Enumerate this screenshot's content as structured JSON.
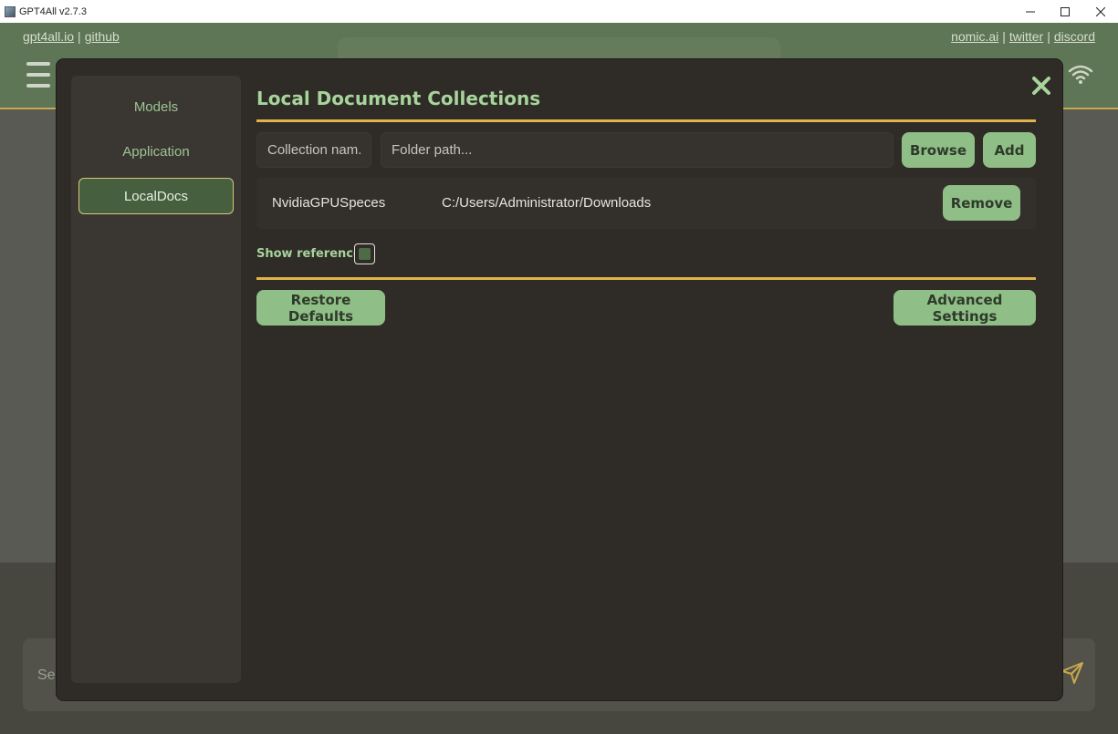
{
  "window": {
    "title": "GPT4All v2.7.3"
  },
  "header": {
    "links_left": [
      "gpt4all.io",
      "github"
    ],
    "links_right": [
      "nomic.ai",
      "twitter",
      "discord"
    ]
  },
  "input": {
    "placeholder": "Se"
  },
  "dialog": {
    "nav": {
      "models": "Models",
      "application": "Application",
      "localdocs": "LocalDocs",
      "active": "LocalDocs"
    },
    "title": "Local Document Collections",
    "collection_name_placeholder": "Collection nam...",
    "folder_path_placeholder": "Folder path...",
    "browse_label": "Browse",
    "add_label": "Add",
    "collections": [
      {
        "name": "NvidiaGPUSpeces",
        "path": "C:/Users/Administrator/Downloads"
      }
    ],
    "remove_label": "Remove",
    "show_references_label": "Show references",
    "show_references_checked": true,
    "restore_defaults_label": "Restore Defaults",
    "advanced_settings_label": "Advanced Settings"
  },
  "colors": {
    "accent_green": "#8fbf86",
    "title_green": "#a6d49b",
    "rule_gold": "#e0b34a",
    "dialog_bg": "#2f2b27",
    "header_bg": "#5e7556"
  }
}
